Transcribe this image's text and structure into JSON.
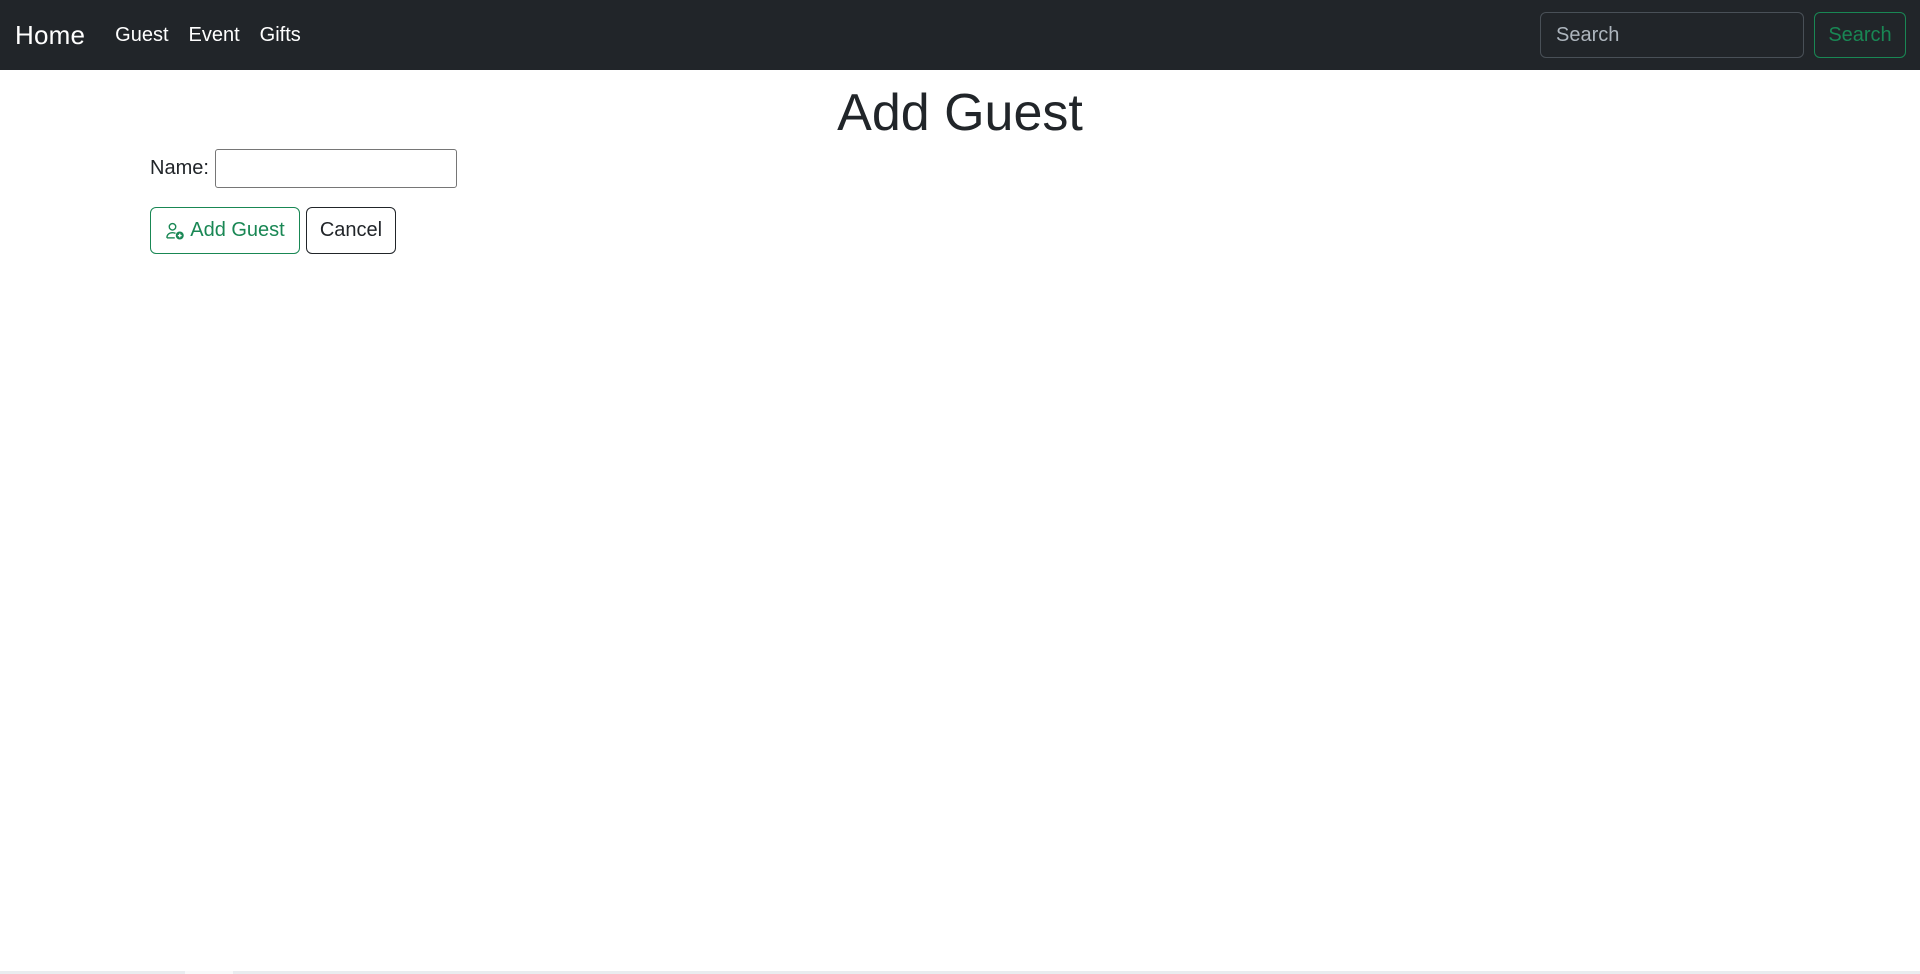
{
  "navbar": {
    "brand": "Home",
    "links": [
      {
        "label": "Guest"
      },
      {
        "label": "Event"
      },
      {
        "label": "Gifts"
      }
    ],
    "search": {
      "placeholder": "Search",
      "button_label": "Search"
    }
  },
  "main": {
    "title": "Add Guest",
    "form": {
      "name_label": "Name:",
      "name_value": "",
      "add_button_label": "Add Guest",
      "add_button_icon": "person-plus-icon",
      "cancel_button_label": "Cancel"
    }
  },
  "colors": {
    "navbar_bg": "#212529",
    "accent_green": "#198754",
    "text_dark": "#212529"
  }
}
